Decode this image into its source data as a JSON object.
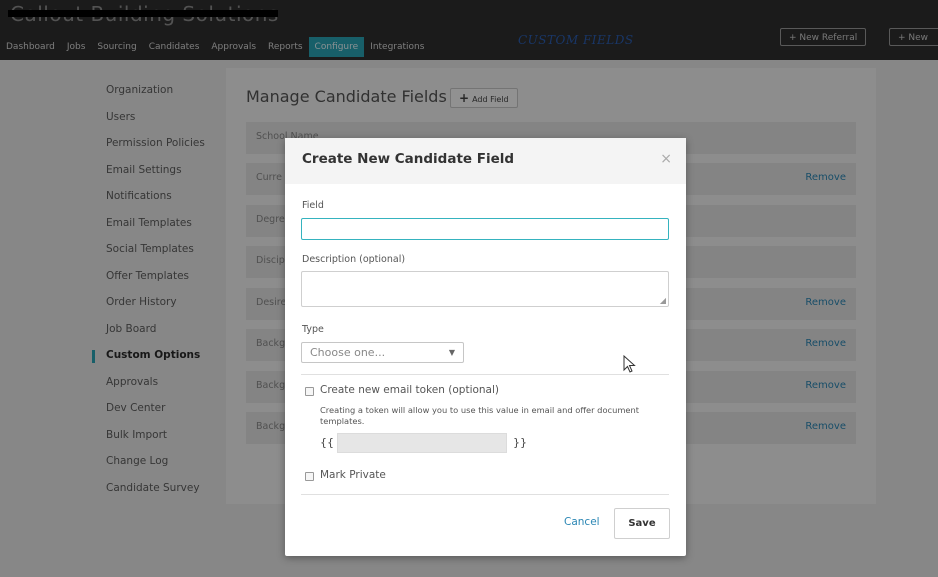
{
  "brand": {
    "text": "Callout Building Solutions"
  },
  "nav": {
    "items": [
      "Dashboard",
      "Jobs",
      "Sourcing",
      "Candidates",
      "Approvals",
      "Reports",
      "Configure",
      "Integrations"
    ],
    "active": "Configure"
  },
  "annotation": "CUSTOM FIELDS",
  "header_buttons": {
    "new_referral": "+ New Referral",
    "new": "+ New"
  },
  "sidebar": {
    "items": [
      "Organization",
      "Users",
      "Permission Policies",
      "Email Settings",
      "Notifications",
      "Email Templates",
      "Social Templates",
      "Offer Templates",
      "Order History",
      "Job Board",
      "Custom Options",
      "Approvals",
      "Dev Center",
      "Bulk Import",
      "Change Log",
      "Candidate Survey"
    ],
    "active": "Custom Options"
  },
  "main": {
    "title": "Manage Candidate Fields",
    "add_field": "Add Field",
    "add_field_icon": "plus-icon",
    "rows": [
      {
        "name": "School Name",
        "remove": ""
      },
      {
        "name": "Curre",
        "remove": "Remove"
      },
      {
        "name": "Degre",
        "remove": ""
      },
      {
        "name": "Discip",
        "remove": ""
      },
      {
        "name": "Desire",
        "remove": "Remove"
      },
      {
        "name": "Backg",
        "remove": "Remove"
      },
      {
        "name": "Backg",
        "remove": "Remove"
      },
      {
        "name": "Backg",
        "remove": "Remove"
      }
    ]
  },
  "modal": {
    "title": "Create New Candidate Field",
    "close": "×",
    "field_label": "Field",
    "field_value": "",
    "description_label": "Description (optional)",
    "description_value": "",
    "type_label": "Type",
    "type_selected": "Choose one...",
    "email_token_label": "Create new email token (optional)",
    "email_token_help": "Creating a token will allow you to use this value in email and offer document templates.",
    "token_open": "{{",
    "token_close": "}}",
    "token_value": "",
    "mark_private_label": "Mark Private",
    "cancel_label": "Cancel",
    "save_label": "Save"
  },
  "colors": {
    "accent": "#2aa4b6",
    "link": "#2a86b4",
    "annotation": "#2b5eb1"
  }
}
